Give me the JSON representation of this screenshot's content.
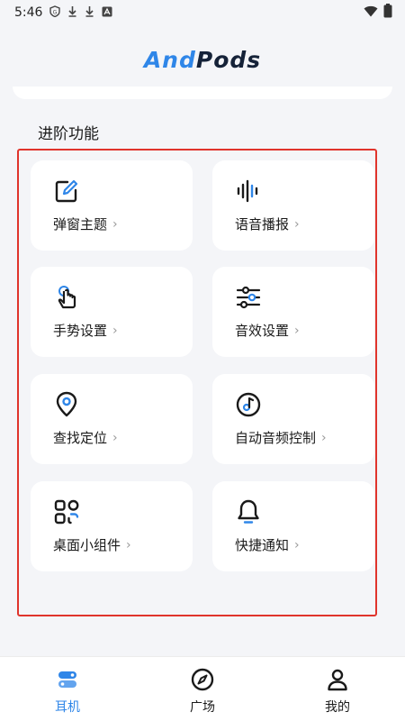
{
  "status_bar": {
    "time": "5:46"
  },
  "app": {
    "logo_part1": "And",
    "logo_part2": "Pods"
  },
  "section": {
    "title": "进阶功能"
  },
  "features": [
    {
      "label": "弹窗主题",
      "icon": "edit-icon"
    },
    {
      "label": "语音播报",
      "icon": "voice-wave-icon"
    },
    {
      "label": "手势设置",
      "icon": "gesture-hand-icon"
    },
    {
      "label": "音效设置",
      "icon": "equalizer-sliders-icon"
    },
    {
      "label": "查找定位",
      "icon": "location-pin-icon"
    },
    {
      "label": "自动音频控制",
      "icon": "music-disc-icon"
    },
    {
      "label": "桌面小组件",
      "icon": "widgets-icon"
    },
    {
      "label": "快捷通知",
      "icon": "bell-icon"
    }
  ],
  "chevron": "›",
  "bottom_nav": {
    "tabs": [
      {
        "label": "耳机",
        "icon": "earbuds-icon",
        "active": true
      },
      {
        "label": "广场",
        "icon": "compass-icon",
        "active": false
      },
      {
        "label": "我的",
        "icon": "person-icon",
        "active": false
      }
    ]
  },
  "colors": {
    "accent": "#2f86e8",
    "frame": "#e0342c",
    "dark": "#152238"
  }
}
